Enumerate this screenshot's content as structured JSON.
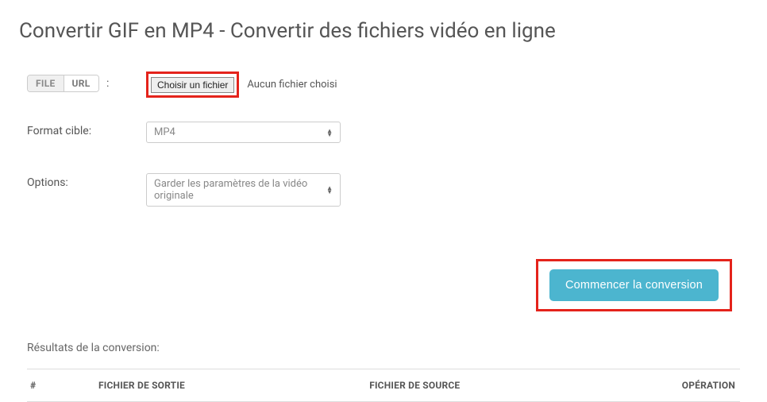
{
  "title": "Convertir GIF en MP4 - Convertir des fichiers vidéo en ligne",
  "sourceToggle": {
    "file": "FILE",
    "url": "URL",
    "colon": ":"
  },
  "fileChooser": {
    "button": "Choisir un fichier",
    "status": "Aucun fichier choisi"
  },
  "labels": {
    "targetFormat": "Format cible:",
    "options": "Options:"
  },
  "selects": {
    "format": "MP4",
    "options": "Garder les paramètres de la vidéo originale"
  },
  "actions": {
    "convert": "Commencer la conversion"
  },
  "results": {
    "title": "Résultats de la conversion:",
    "headers": {
      "index": "#",
      "output": "FICHIER DE SORTIE",
      "source": "FICHIER DE SOURCE",
      "operation": "OPÉRATION"
    }
  }
}
